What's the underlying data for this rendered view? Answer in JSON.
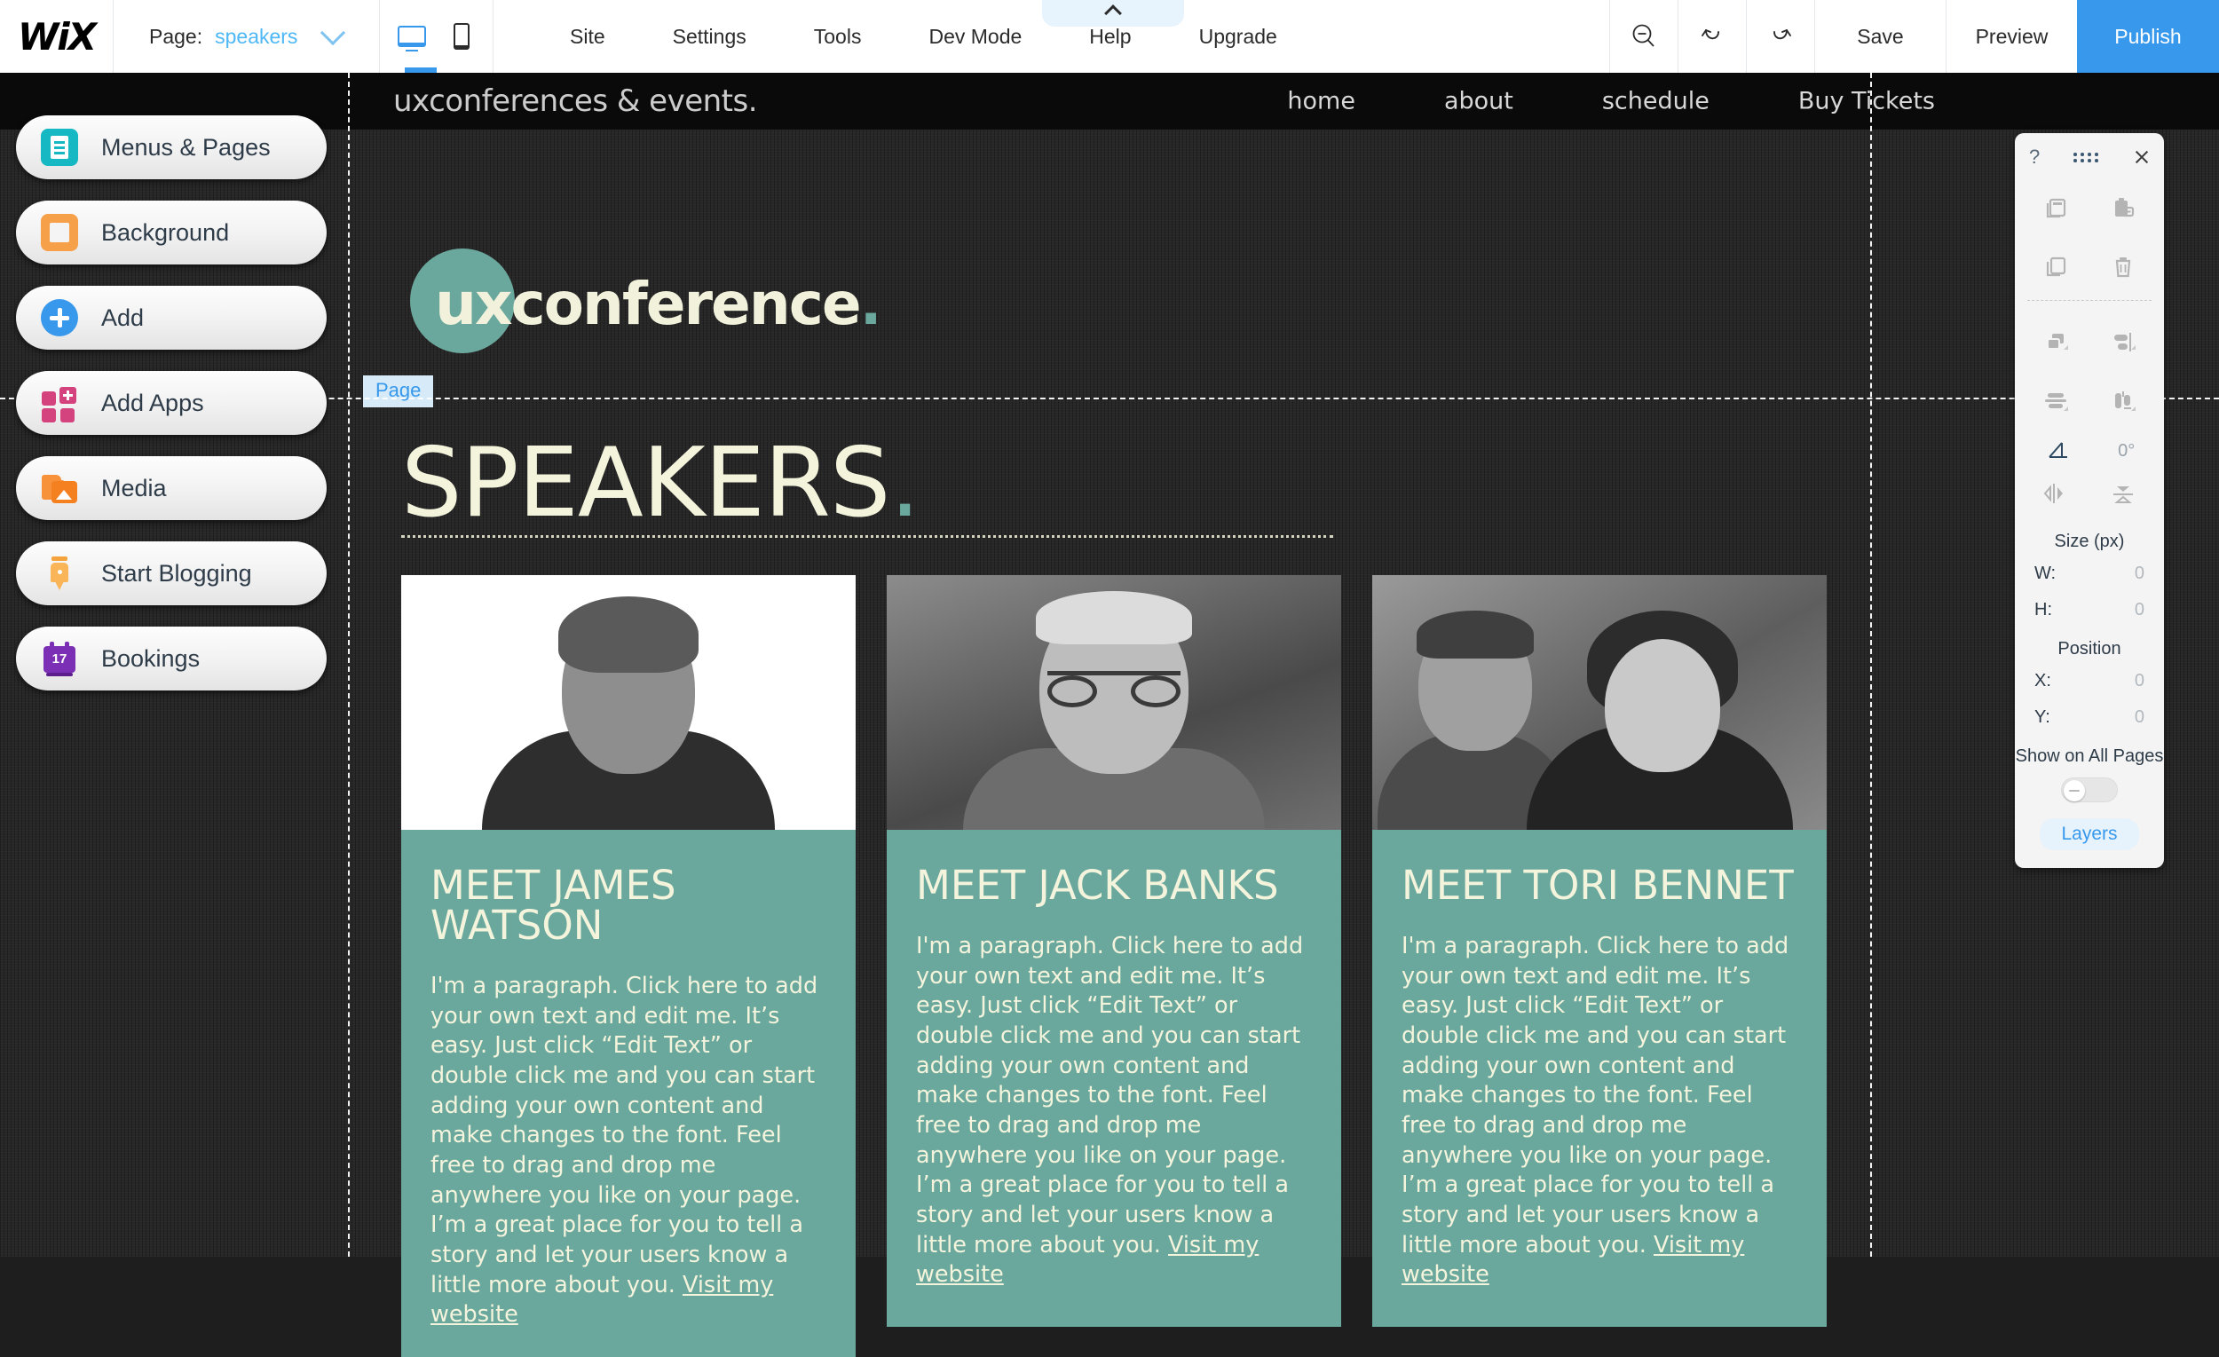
{
  "editor": {
    "brand": "WiX",
    "page_selector": {
      "label": "Page:",
      "value": "speakers"
    },
    "device_tabs": [
      {
        "name": "desktop-view",
        "active": true
      },
      {
        "name": "mobile-view",
        "active": false
      }
    ],
    "menu": [
      "Site",
      "Settings",
      "Tools",
      "Dev Mode",
      "Help",
      "Upgrade"
    ],
    "right_actions": {
      "zoom_out_icon": "zoom-out-icon",
      "undo_icon": "undo-icon",
      "redo_icon": "redo-icon",
      "save": "Save",
      "preview": "Preview",
      "publish": "Publish"
    },
    "accent_blue": "#3899ec"
  },
  "sidebar": {
    "items": [
      {
        "label": "Menus & Pages",
        "icon": "pages-icon",
        "color": "#16b8c4"
      },
      {
        "label": "Background",
        "icon": "background-icon",
        "color": "#f7a04a"
      },
      {
        "label": "Add",
        "icon": "add-plus-icon",
        "color": "#3899ec"
      },
      {
        "label": "Add Apps",
        "icon": "apps-grid-icon",
        "color": "#d5437f"
      },
      {
        "label": "Media",
        "icon": "media-image-icon",
        "color": "#f5801f"
      },
      {
        "label": "Start Blogging",
        "icon": "pen-nib-icon",
        "color": "#f9b558"
      },
      {
        "label": "Bookings",
        "icon": "calendar-icon",
        "color": "#7b2fb5"
      }
    ]
  },
  "site": {
    "header": {
      "brand": "uxconferences & events.",
      "nav": [
        "home",
        "about",
        "schedule",
        "Buy Tickets"
      ]
    },
    "logo": {
      "text": "uxconference",
      "dot": ".",
      "circle_color": "#6aa79c",
      "text_color": "#f2f2dc"
    },
    "page_tag": "Page",
    "page_title": "SPEAKERS",
    "page_title_dot": ".",
    "card_bg": "#6aa79c",
    "card_text_color": "#f4f4dd",
    "speakers": [
      {
        "title": "MEET JAMES WATSON",
        "body": "I'm a paragraph. Click here to add your own text and edit me. It’s easy. Just click “Edit Text” or double click me and you can start adding your own content and make changes to the font. Feel free to drag and drop me anywhere you like on your page. I’m a great place for you to tell a story and let your users know a little more about you. ",
        "link": "Visit my website",
        "photo": "portrait-man-smiling"
      },
      {
        "title": "MEET JACK BANKS",
        "body": "I'm a paragraph. Click here to add your own text and edit me. It’s easy. Just click “Edit Text” or double click me and you can start adding your own content and make changes to the font. Feel free to drag and drop me anywhere you like on your page. I’m a great place for you to tell a story and let your users know a little more about you. ",
        "link": "Visit my website",
        "photo": "portrait-older-man-glasses"
      },
      {
        "title": "MEET TORI BENNET",
        "body": "I'm a paragraph. Click here to add your own text and edit me. It’s easy. Just click “Edit Text” or double click me and you can start adding your own content and make changes to the font. Feel free to drag and drop me anywhere you like on your page. I’m a great place for you to tell a story and let your users know a little more about you. ",
        "link": "Visit my website",
        "photo": "portrait-two-colleagues"
      }
    ]
  },
  "float_toolbar": {
    "help": "?",
    "drag_handle": "drag-dots-icon",
    "close": "close-icon",
    "actions": [
      {
        "icon": "copy-icon"
      },
      {
        "icon": "paste-icon"
      },
      {
        "icon": "duplicate-icon"
      },
      {
        "icon": "delete-trash-icon"
      }
    ],
    "arrange": [
      {
        "icon": "arrange-order-icon"
      },
      {
        "icon": "align-horizontal-icon"
      },
      {
        "icon": "distribute-vertical-icon"
      },
      {
        "icon": "align-vertical-icon"
      }
    ],
    "rotate": {
      "icon": "rotate-angle-icon",
      "value": "0°"
    },
    "flip": [
      {
        "icon": "flip-horizontal-icon"
      },
      {
        "icon": "flip-vertical-icon"
      }
    ],
    "size": {
      "title": "Size (px)",
      "w_label": "W:",
      "w_value": "0",
      "h_label": "H:",
      "h_value": "0"
    },
    "position": {
      "title": "Position",
      "x_label": "X:",
      "x_value": "0",
      "y_label": "Y:",
      "y_value": "0"
    },
    "show_all_pages": {
      "label": "Show on All Pages",
      "enabled": false
    },
    "layers": "Layers"
  }
}
